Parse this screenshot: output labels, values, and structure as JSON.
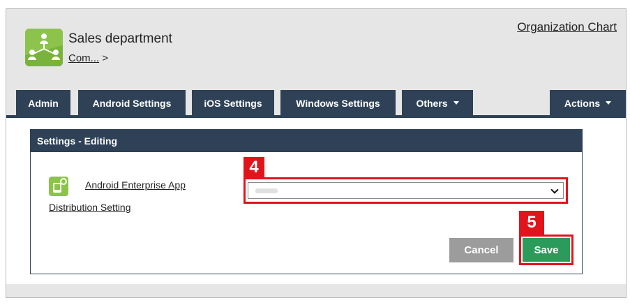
{
  "header": {
    "title": "Sales department",
    "breadcrumb_link": "Com...",
    "breadcrumb_sep": ">",
    "org_chart_link": "Organization Chart"
  },
  "tabs": [
    {
      "label": "Admin"
    },
    {
      "label": "Android Settings"
    },
    {
      "label": "iOS Settings"
    },
    {
      "label": "Windows Settings"
    },
    {
      "label": "Others"
    },
    {
      "label": "Actions"
    }
  ],
  "panel": {
    "title": "Settings - Editing",
    "setting_label_line1": "Android Enterprise App",
    "setting_label_line2": "Distribution Setting",
    "select_value": ""
  },
  "buttons": {
    "cancel": "Cancel",
    "save": "Save"
  },
  "callouts": {
    "step4": "4",
    "step5": "5"
  },
  "icons": {
    "org_icon": "organization-tree-icon",
    "setting_icon": "app-distribution-icon",
    "dropdown_caret": "caret-down-icon",
    "select_chevron": "chevron-down-icon"
  },
  "colors": {
    "nav": "#2e4156",
    "accent_green": "#8cc34a",
    "save": "#2b9b5b",
    "cancel": "#9c9c9c",
    "callout_red": "#e1141c"
  }
}
